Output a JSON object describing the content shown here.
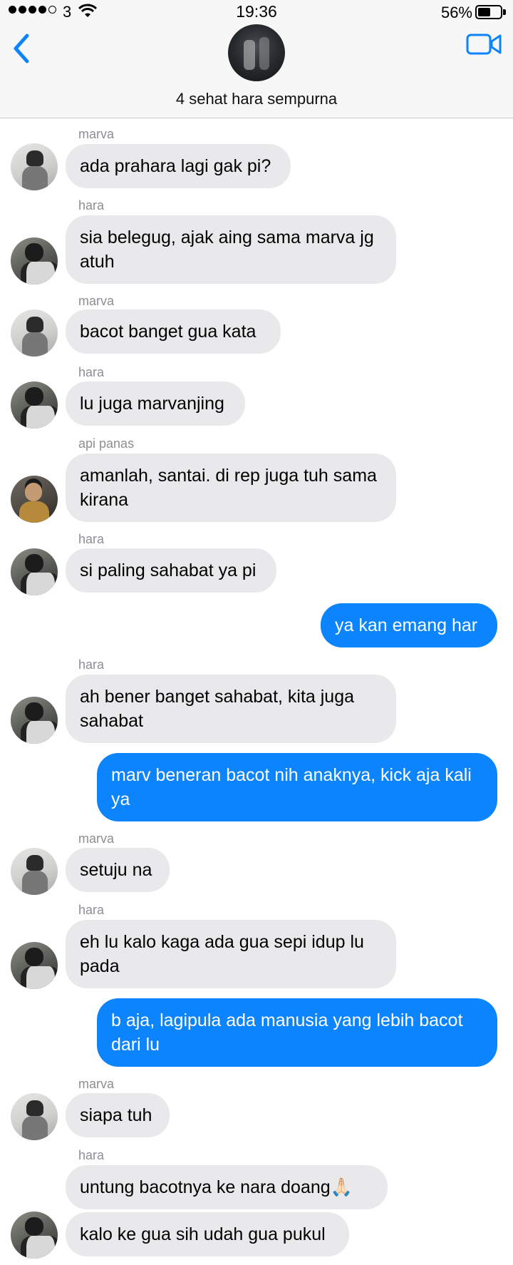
{
  "status_bar": {
    "carrier": "3",
    "time": "19:36",
    "battery_percent": "56%",
    "battery_level": 0.56
  },
  "header": {
    "group_name": "4 sehat hara sempurna",
    "back_icon": "chevron-left-icon",
    "video_icon": "video-camera-icon"
  },
  "colors": {
    "incoming_bubble": "#e9e9eb",
    "outgoing_bubble": "#0b84fe",
    "accent": "#0b84fe"
  },
  "messages": [
    {
      "sender": "marva",
      "text": "ada prahara lagi gak pi?"
    },
    {
      "sender": "hara",
      "text": "sia belegug, ajak aing sama marva jg atuh"
    },
    {
      "sender": "marva",
      "text": "bacot banget gua kata"
    },
    {
      "sender": "hara",
      "text": "lu juga marvanjing"
    },
    {
      "sender": "api panas",
      "text": "amanlah, santai. di rep juga tuh sama kirana"
    },
    {
      "sender": "hara",
      "text": "si paling sahabat ya pi"
    },
    {
      "sender": "me",
      "text": "ya kan emang har"
    },
    {
      "sender": "hara",
      "text": "ah bener banget sahabat, kita juga sahabat"
    },
    {
      "sender": "me",
      "text": "marv beneran bacot nih anaknya, kick aja kali ya"
    },
    {
      "sender": "marva",
      "text": "setuju na"
    },
    {
      "sender": "hara",
      "text": "eh lu kalo kaga ada gua sepi idup lu pada"
    },
    {
      "sender": "me",
      "text": "b aja, lagipula ada manusia yang lebih bacot dari lu"
    },
    {
      "sender": "marva",
      "text": "siapa tuh"
    },
    {
      "sender": "hara",
      "text": "untung bacotnya ke nara doang🙏🏻"
    },
    {
      "sender": "hara",
      "text": "kalo ke gua sih udah gua pukul"
    }
  ]
}
